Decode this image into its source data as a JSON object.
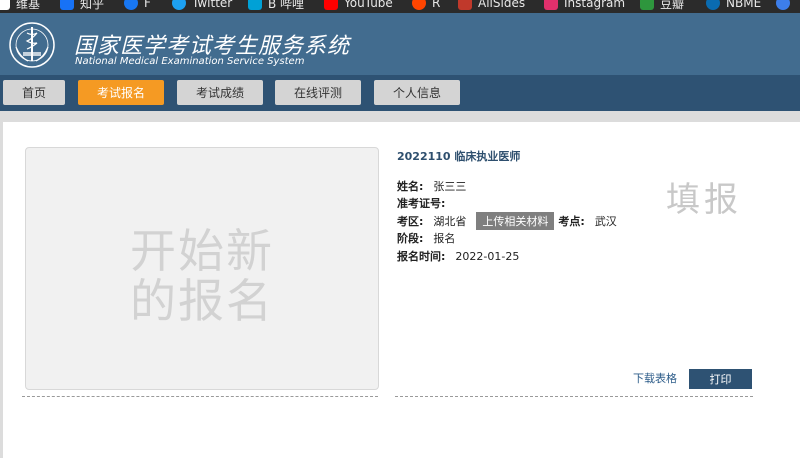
{
  "bookmarks": [
    {
      "icon": "wiki-icon",
      "label": "维基",
      "color": "#ffffff"
    },
    {
      "icon": "zhihu-icon",
      "label": "知乎",
      "color": "#1772f6"
    },
    {
      "icon": "facebook-icon",
      "label": "F",
      "color": "#1877f2"
    },
    {
      "icon": "twitter-icon",
      "label": "Twitter",
      "color": "#1da1f2"
    },
    {
      "icon": "bilibili-icon",
      "label": "B 哔哩",
      "color": "#00a1d6"
    },
    {
      "icon": "youtube-icon",
      "label": "YouTube",
      "color": "#ff0000"
    },
    {
      "icon": "r-icon",
      "label": "R",
      "color": "#ff4500"
    },
    {
      "icon": "allsides-icon",
      "label": "AllSides",
      "color": "#c0392b"
    },
    {
      "icon": "instagram-icon",
      "label": "Instagram",
      "color": "#e1306c"
    },
    {
      "icon": "douban-icon",
      "label": "豆瓣",
      "color": "#2e963d"
    },
    {
      "icon": "nbme-icon",
      "label": "NBME",
      "color": "#0a6bb0"
    }
  ],
  "header": {
    "title_zh": "国家医学考试考生服务系统",
    "title_en": "National Medical Examination Service System"
  },
  "nav": {
    "tabs": [
      {
        "label": "首页",
        "active": false
      },
      {
        "label": "考试报名",
        "active": true
      },
      {
        "label": "考试成绩",
        "active": false
      },
      {
        "label": "在线评测",
        "active": false
      },
      {
        "label": "个人信息",
        "active": false
      }
    ]
  },
  "photo": {
    "line1": "开始新",
    "line2": "的报名"
  },
  "exam": {
    "title": "2022110 临床执业医师",
    "name_label": "姓名:",
    "name_value": "张三三",
    "admission_label": "准考证号:",
    "admission_value": "",
    "region_label": "考区:",
    "region_value": "湖北省",
    "upload_label": "上传相关材料",
    "site_label": "考点:",
    "site_value": "武汉",
    "stage_label": "阶段:",
    "stage_value": "报名",
    "date_label": "报名时间:",
    "date_value": "2022-01-25",
    "stamp": "填报"
  },
  "actions": {
    "download_label": "下载表格",
    "print_label": "打印"
  },
  "colors": {
    "header_bg": "#426c8f",
    "nav_bg": "#2e5273",
    "active_tab": "#f59a23"
  }
}
